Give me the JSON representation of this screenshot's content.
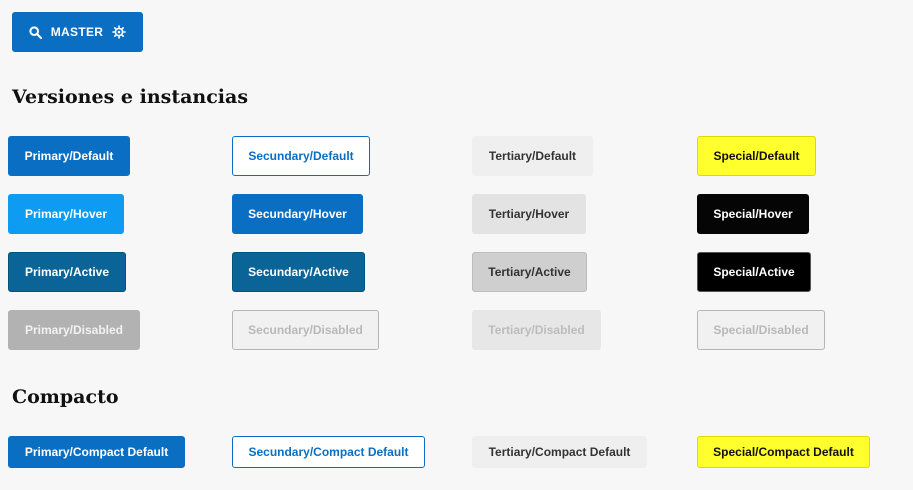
{
  "master": {
    "label": "MASTER",
    "icons": [
      "search-icon",
      "settings-gear-icon"
    ]
  },
  "sections": {
    "versions_title": "Versiones e instancias",
    "compact_title": "Compacto"
  },
  "buttons": {
    "primary": {
      "default": "Primary/Default",
      "hover": "Primary/Hover",
      "active": "Primary/Active",
      "disabled": "Primary/Disabled",
      "compact": "Primary/Compact Default"
    },
    "secundary": {
      "default": "Secundary/Default",
      "hover": "Secundary/Hover",
      "active": "Secundary/Active",
      "disabled": "Secundary/Disabled",
      "compact": "Secundary/Compact Default"
    },
    "tertiary": {
      "default": "Tertiary/Default",
      "hover": "Tertiary/Hover",
      "active": "Tertiary/Active",
      "disabled": "Tertiary/Disabled",
      "compact": "Tertiary/Compact Default"
    },
    "special": {
      "default": "Special/Default",
      "hover": "Special/Hover",
      "active": "Special/Active",
      "disabled": "Special/Disabled",
      "compact": "Special/Compact Default"
    }
  },
  "colors": {
    "primary_blue": "#0a6fc2",
    "hover_blue": "#0d9cf1",
    "active_blue": "#0a6497",
    "special_yellow": "#ffff2e",
    "special_black": "#000000",
    "disabled_gray": "#b2b2b2"
  }
}
